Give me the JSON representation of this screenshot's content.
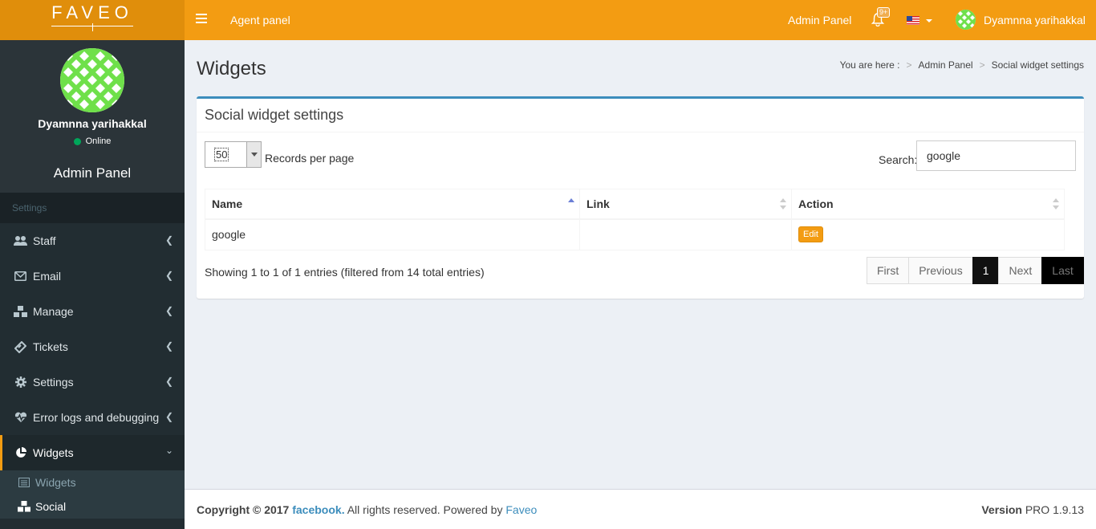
{
  "brand": {
    "logo_text": "FAVEO"
  },
  "sidebar": {
    "user_name": "Dyamnna yarihakkal",
    "status": "Online",
    "panel_title": "Admin Panel",
    "section_header": "Settings",
    "items": [
      {
        "label": "Staff",
        "icon": "users-icon"
      },
      {
        "label": "Email",
        "icon": "envelope-icon"
      },
      {
        "label": "Manage",
        "icon": "cubes-icon"
      },
      {
        "label": "Tickets",
        "icon": "ticket-icon"
      },
      {
        "label": "Settings",
        "icon": "gear-icon"
      },
      {
        "label": "Error logs and debugging",
        "icon": "heartbeat-icon"
      },
      {
        "label": "Widgets",
        "icon": "pie-chart-icon"
      }
    ],
    "subitems": [
      {
        "label": "Widgets",
        "icon": "list-icon"
      },
      {
        "label": "Social",
        "icon": "cubes-icon"
      }
    ]
  },
  "navbar": {
    "agent_panel": "Agent panel",
    "admin_panel": "Admin Panel",
    "notification_badge": "9+",
    "user_name": "Dyamnna yarihakkal"
  },
  "page": {
    "title": "Widgets",
    "breadcrumb": {
      "prefix": "You are here :",
      "items": [
        "Admin Panel",
        "Social widget settings"
      ]
    }
  },
  "box": {
    "title": "Social widget settings",
    "records_per_page_value": "50",
    "records_per_page_label": "Records per page",
    "search_label": "Search:",
    "search_value": "google",
    "columns": [
      "Name",
      "Link",
      "Action"
    ],
    "rows": [
      {
        "name": "google",
        "link": "",
        "action": "Edit"
      }
    ],
    "info": "Showing 1 to 1 of 1 entries (filtered from 14 total entries)",
    "pagination": {
      "first": "First",
      "previous": "Previous",
      "current": "1",
      "next": "Next",
      "last": "Last"
    }
  },
  "footer": {
    "copyright": "Copyright © 2017",
    "company": "facebook.",
    "rights": "All rights reserved. Powered by",
    "powered_by": "Faveo",
    "version_label": "Version",
    "version_value": "PRO 1.9.13"
  },
  "colors": {
    "accent": "#f39c12",
    "sidebar": "#222d32",
    "box_top": "#3c8dbc"
  }
}
